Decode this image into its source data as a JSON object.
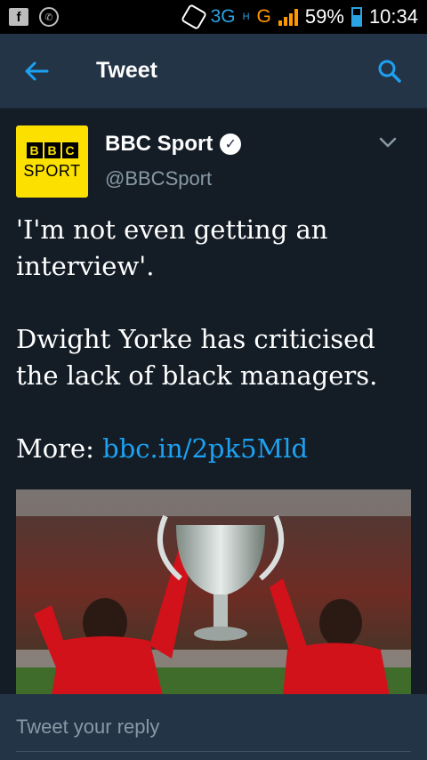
{
  "status_bar": {
    "network": "3G",
    "network_sub": "H",
    "sim": "G",
    "battery_pct": "59%",
    "time": "10:34"
  },
  "app_bar": {
    "title": "Tweet"
  },
  "tweet": {
    "author_name": "BBC Sport",
    "author_handle": "@BBCSport",
    "avatar_logo": "BBC SPORT",
    "text_line1": "'I'm not even getting an interview'.",
    "text_line2": "Dwight Yorke has criticised the lack of black managers.",
    "more_label": "More:",
    "more_link": "bbc.in/2pk5Mld"
  },
  "reply": {
    "placeholder": "Tweet your reply"
  },
  "colors": {
    "background": "#141d26",
    "bar": "#243447",
    "accent": "#1da1f2",
    "muted": "#8899a6"
  }
}
